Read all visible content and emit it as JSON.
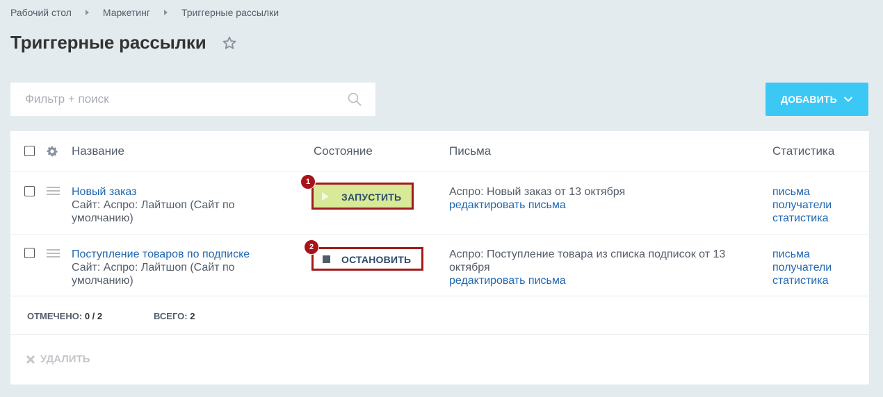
{
  "breadcrumb": [
    "Рабочий стол",
    "Маркетинг",
    "Триггерные рассылки"
  ],
  "page_title": "Триггерные рассылки",
  "filter": {
    "placeholder": "Фильтр + поиск",
    "value": ""
  },
  "add_button": {
    "label": "ДОБАВИТЬ"
  },
  "table": {
    "headers": {
      "name": "Название",
      "state": "Состояние",
      "letters": "Письма",
      "stats": "Статистика"
    },
    "rows": [
      {
        "name": "Новый заказ",
        "site_line1": "Сайт: Аспро: Лайтшоп (Сайт по",
        "site_line2": "умолчанию)",
        "badge": "1",
        "action": "ЗАПУСТИТЬ",
        "letter_line1": "Аспро: Новый заказ от 13 октября",
        "letter_line2": "",
        "edit_link": "редактировать письма",
        "stats": [
          "письма",
          "получатели",
          "статистика"
        ]
      },
      {
        "name": "Поступление товаров по подписке",
        "site_line1": "Сайт: Аспро: Лайтшоп (Сайт по",
        "site_line2": "умолчанию)",
        "badge": "2",
        "action": "ОСТАНОВИТЬ",
        "letter_line1": "Аспро: Поступление товара из списка подписок от 13",
        "letter_line2": "октября",
        "edit_link": "редактировать письма",
        "stats": [
          "письма",
          "получатели",
          "статистика"
        ]
      }
    ]
  },
  "footer": {
    "selected_label": "ОТМЕЧЕНО:",
    "selected_value": "0 / 2",
    "total_label": "ВСЕГО:",
    "total_value": "2"
  },
  "delete_button": {
    "label": "УДАЛИТЬ"
  },
  "colors": {
    "background": "#e4ebee",
    "link": "#2067b0",
    "accent": "#3bc8f5",
    "start_bg": "#d8ea98",
    "highlight_border": "#a11a1a"
  },
  "icons": [
    "star-icon",
    "search-icon",
    "chevron-down-icon",
    "gear-icon",
    "drag-handle-icon",
    "play-icon",
    "stop-icon",
    "close-icon"
  ]
}
